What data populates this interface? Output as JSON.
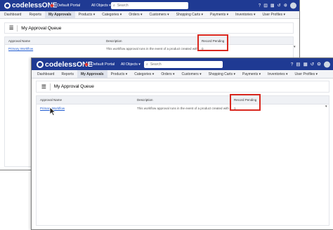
{
  "app": {
    "brand": "codelessONE",
    "portal": "Default Portal",
    "objects_selector": "All Objects",
    "search_placeholder": "Search"
  },
  "nav": {
    "tabs": [
      {
        "label": "Dashboard"
      },
      {
        "label": "Reports"
      },
      {
        "label": "My Approvals"
      },
      {
        "label": "Products"
      },
      {
        "label": "Categories"
      },
      {
        "label": "Orders"
      },
      {
        "label": "Customers"
      },
      {
        "label": "Shopping Carts"
      },
      {
        "label": "Payments"
      },
      {
        "label": "Inventories"
      },
      {
        "label": "User Profiles"
      }
    ]
  },
  "page": {
    "title": "My Approval Queue"
  },
  "grid": {
    "columns": [
      "Approval Name",
      "Description",
      "Record Pending"
    ],
    "rows": [
      {
        "approval_name": "Primary Workflow",
        "description": "This workflow approval runs in the event of a product created with v...",
        "record_pending": "0"
      }
    ]
  },
  "grid_updated": {
    "rows": [
      {
        "approval_name": "Primary Workflow",
        "description": "This workflow approval runs in the event of a product created with v...",
        "record_pending": "1"
      }
    ]
  },
  "icons": [
    "codeless-logo-icon",
    "search-icon",
    "help-icon",
    "document-icon",
    "grid-icon",
    "history-icon",
    "settings-icon",
    "avatar",
    "list-icon",
    "chevron-down-icon",
    "mouse-cursor-icon"
  ],
  "colors": {
    "topbar": "#1f3a93",
    "highlight": "#d9281f",
    "link": "#1f5bd1",
    "active_tab": "#dfe3ec"
  }
}
